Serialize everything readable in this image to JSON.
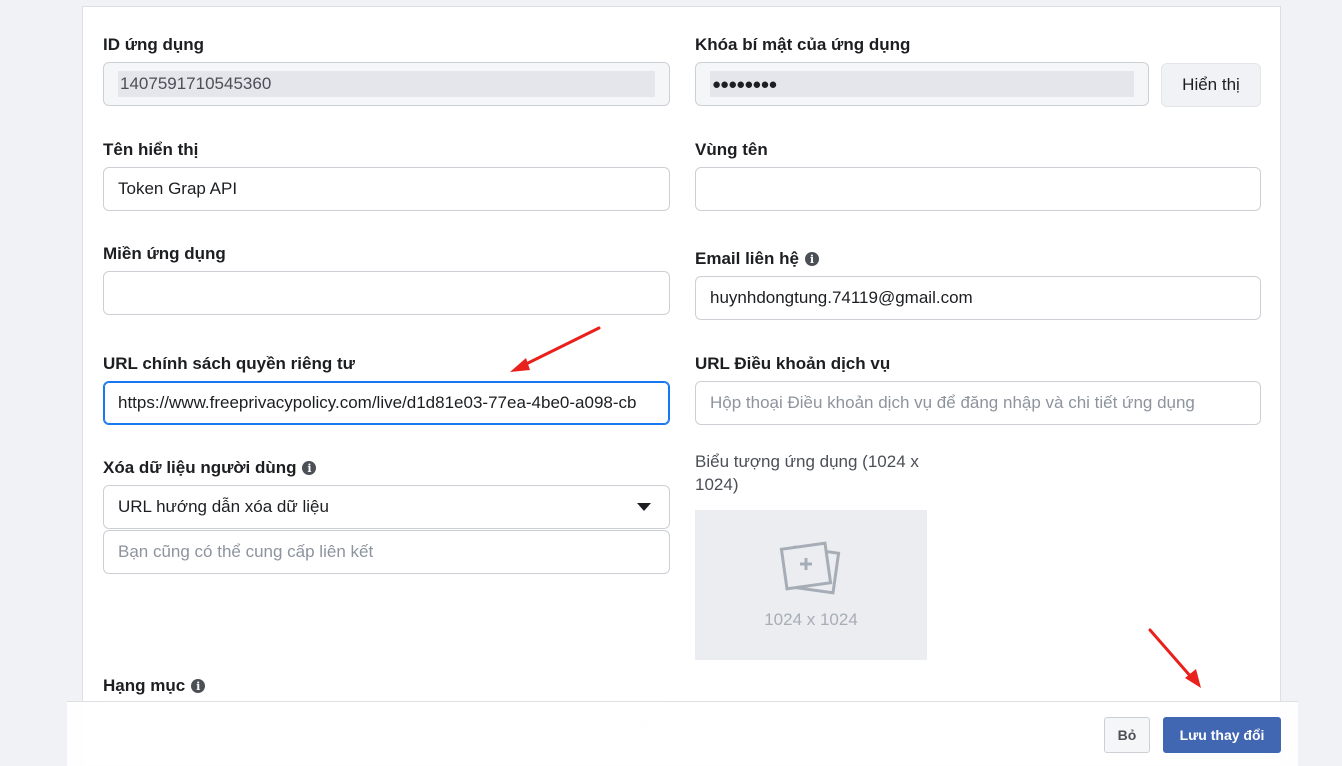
{
  "form": {
    "app_id": {
      "label": "ID ứng dụng",
      "value": "1407591710545360"
    },
    "app_secret": {
      "label": "Khóa bí mật của ứng dụng",
      "value": "●●●●●●●●",
      "show_button": "Hiển thị"
    },
    "display_name": {
      "label": "Tên hiển thị",
      "value": "Token Grap API"
    },
    "namespace": {
      "label": "Vùng tên",
      "value": ""
    },
    "app_domains": {
      "label": "Miền ứng dụng",
      "value": ""
    },
    "contact_email": {
      "label": "Email liên hệ",
      "value": "huynhdongtung.74119@gmail.com"
    },
    "privacy_url": {
      "label": "URL chính sách quyền riêng tư",
      "value": "https://www.freeprivacypolicy.com/live/d1d81e03-77ea-4be0-a098-cb"
    },
    "tos_url": {
      "label": "URL Điều khoản dịch vụ",
      "placeholder": "Hộp thoại Điều khoản dịch vụ để đăng nhập và chi tiết ứng dụng"
    },
    "data_deletion": {
      "label": "Xóa dữ liệu người dùng",
      "selected": "URL hướng dẫn xóa dữ liệu",
      "placeholder": "Bạn cũng có thể cung cấp liên kết"
    },
    "app_icon": {
      "label": "Biểu tượng ứng dụng (1024 x 1024)",
      "size_text": "1024 x 1024"
    },
    "category": {
      "label": "Hạng mục",
      "selected": ""
    }
  },
  "footer": {
    "cancel_label": "Bỏ",
    "save_label": "Lưu thay đổi"
  },
  "colors": {
    "accent": "#4267b2",
    "focus": "#1877f2",
    "annotation_arrow": "#e8211c"
  },
  "icons": [
    "info-icon",
    "image-placeholder-icon",
    "chevron-down-icon"
  ]
}
